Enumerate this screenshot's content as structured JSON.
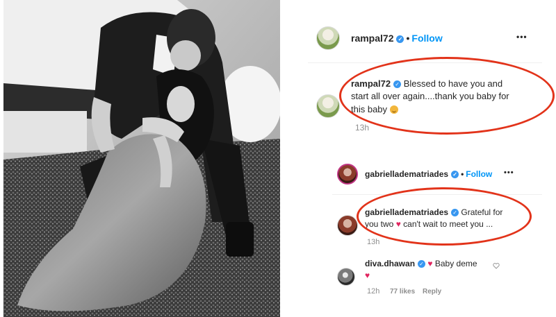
{
  "photo": {
    "alt_subject": "couple-photo"
  },
  "post": {
    "author": "rampal72",
    "separator": "•",
    "follow_label": "Follow",
    "more_label": "•••"
  },
  "caption": {
    "author": "rampal72",
    "text": "Blessed to have you and start all over again....thank you baby for this baby",
    "time": "13h"
  },
  "reply_post": {
    "author": "gabrielladematriades",
    "separator": "•",
    "follow_label": "Follow",
    "more_label": "•••"
  },
  "reply_comment": {
    "author": "gabrielladematriades",
    "text_before_heart": "Grateful for you two",
    "text_after_heart": "can't wait to meet you ...",
    "time": "13h"
  },
  "diva_comment": {
    "author": "diva.dhawan",
    "text": "Baby deme",
    "time": "12h",
    "likes": "77 likes",
    "reply_label": "Reply"
  },
  "colors": {
    "highlight": "#e2331a",
    "verified": "#3897f0",
    "follow": "#0095f6",
    "heart": "#e0245e"
  },
  "icons": {
    "verified": "verified-badge-icon",
    "heart": "heart-icon",
    "more": "more-options-icon",
    "like": "like-heart-icon"
  }
}
